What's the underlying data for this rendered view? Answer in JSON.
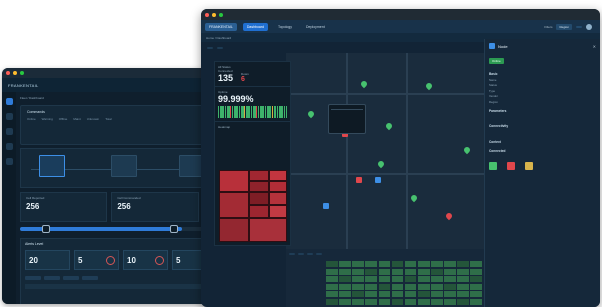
{
  "back_window": {
    "brand": "FRANKENTAIL",
    "url": "",
    "breadcrumb": "Fleet / Dashboard",
    "command_title": "Commands",
    "command_subtitle": "",
    "tl_labels": [
      "Online",
      "Warning",
      "Offline",
      "Maint",
      "Unknown",
      "Total"
    ],
    "stats": [
      {
        "label": "Cell Reported",
        "value": "256"
      },
      {
        "label": "Cell Commanded",
        "value": "256"
      }
    ],
    "alerts_title": "Alerts Level",
    "alerts": [
      {
        "label": "Total",
        "value": "20"
      },
      {
        "label": "Critical",
        "value": "5"
      },
      {
        "label": "Major",
        "value": "10"
      },
      {
        "label": "Minor",
        "value": "5"
      }
    ]
  },
  "front_window": {
    "url": "",
    "nav": {
      "brand": "FRANKENTAIL",
      "tabs": [
        "Dashboard",
        "Topology",
        "Deployment"
      ],
      "right_label": "Filters",
      "right_select": "Region",
      "right_select2": "",
      "user": ""
    },
    "breadcrumb": "Home / Dashboard",
    "tools": [
      "",
      ""
    ],
    "left_panel": {
      "status_label": "All Status",
      "connected_label": "Connected",
      "connected_value": "135",
      "down_label": "Down",
      "down_value": "6",
      "uptime_label": "Uptime",
      "uptime_value": "99.999%",
      "heatmap_label": "Heatmap"
    },
    "popup": {
      "title": "",
      "line1": "",
      "line2": ""
    },
    "details": {
      "title": "Node",
      "badge": "Online",
      "sections": [
        {
          "title": "Basic",
          "rows": [
            [
              "Name",
              ""
            ],
            [
              "Status",
              ""
            ],
            [
              "Type",
              ""
            ],
            [
              "Vendor",
              ""
            ],
            [
              "Region",
              ""
            ]
          ]
        },
        {
          "title": "Parameters",
          "rows": [
            [
              "",
              ""
            ],
            [
              "",
              ""
            ],
            [
              "",
              ""
            ],
            [
              "",
              ""
            ]
          ]
        },
        {
          "title": "Connectivity",
          "rows": [
            [
              "",
              ""
            ],
            [
              "",
              ""
            ],
            [
              "",
              ""
            ],
            [
              "",
              ""
            ]
          ]
        },
        {
          "title": "Context",
          "rows": []
        },
        {
          "title": "Connected",
          "rows": [
            [
              "",
              ""
            ],
            [
              "",
              ""
            ],
            [
              "",
              ""
            ]
          ]
        }
      ]
    },
    "bottom": {
      "pills": [
        "",
        "",
        "",
        ""
      ],
      "rows": [
        "",
        "",
        "",
        "",
        "",
        ""
      ]
    }
  }
}
